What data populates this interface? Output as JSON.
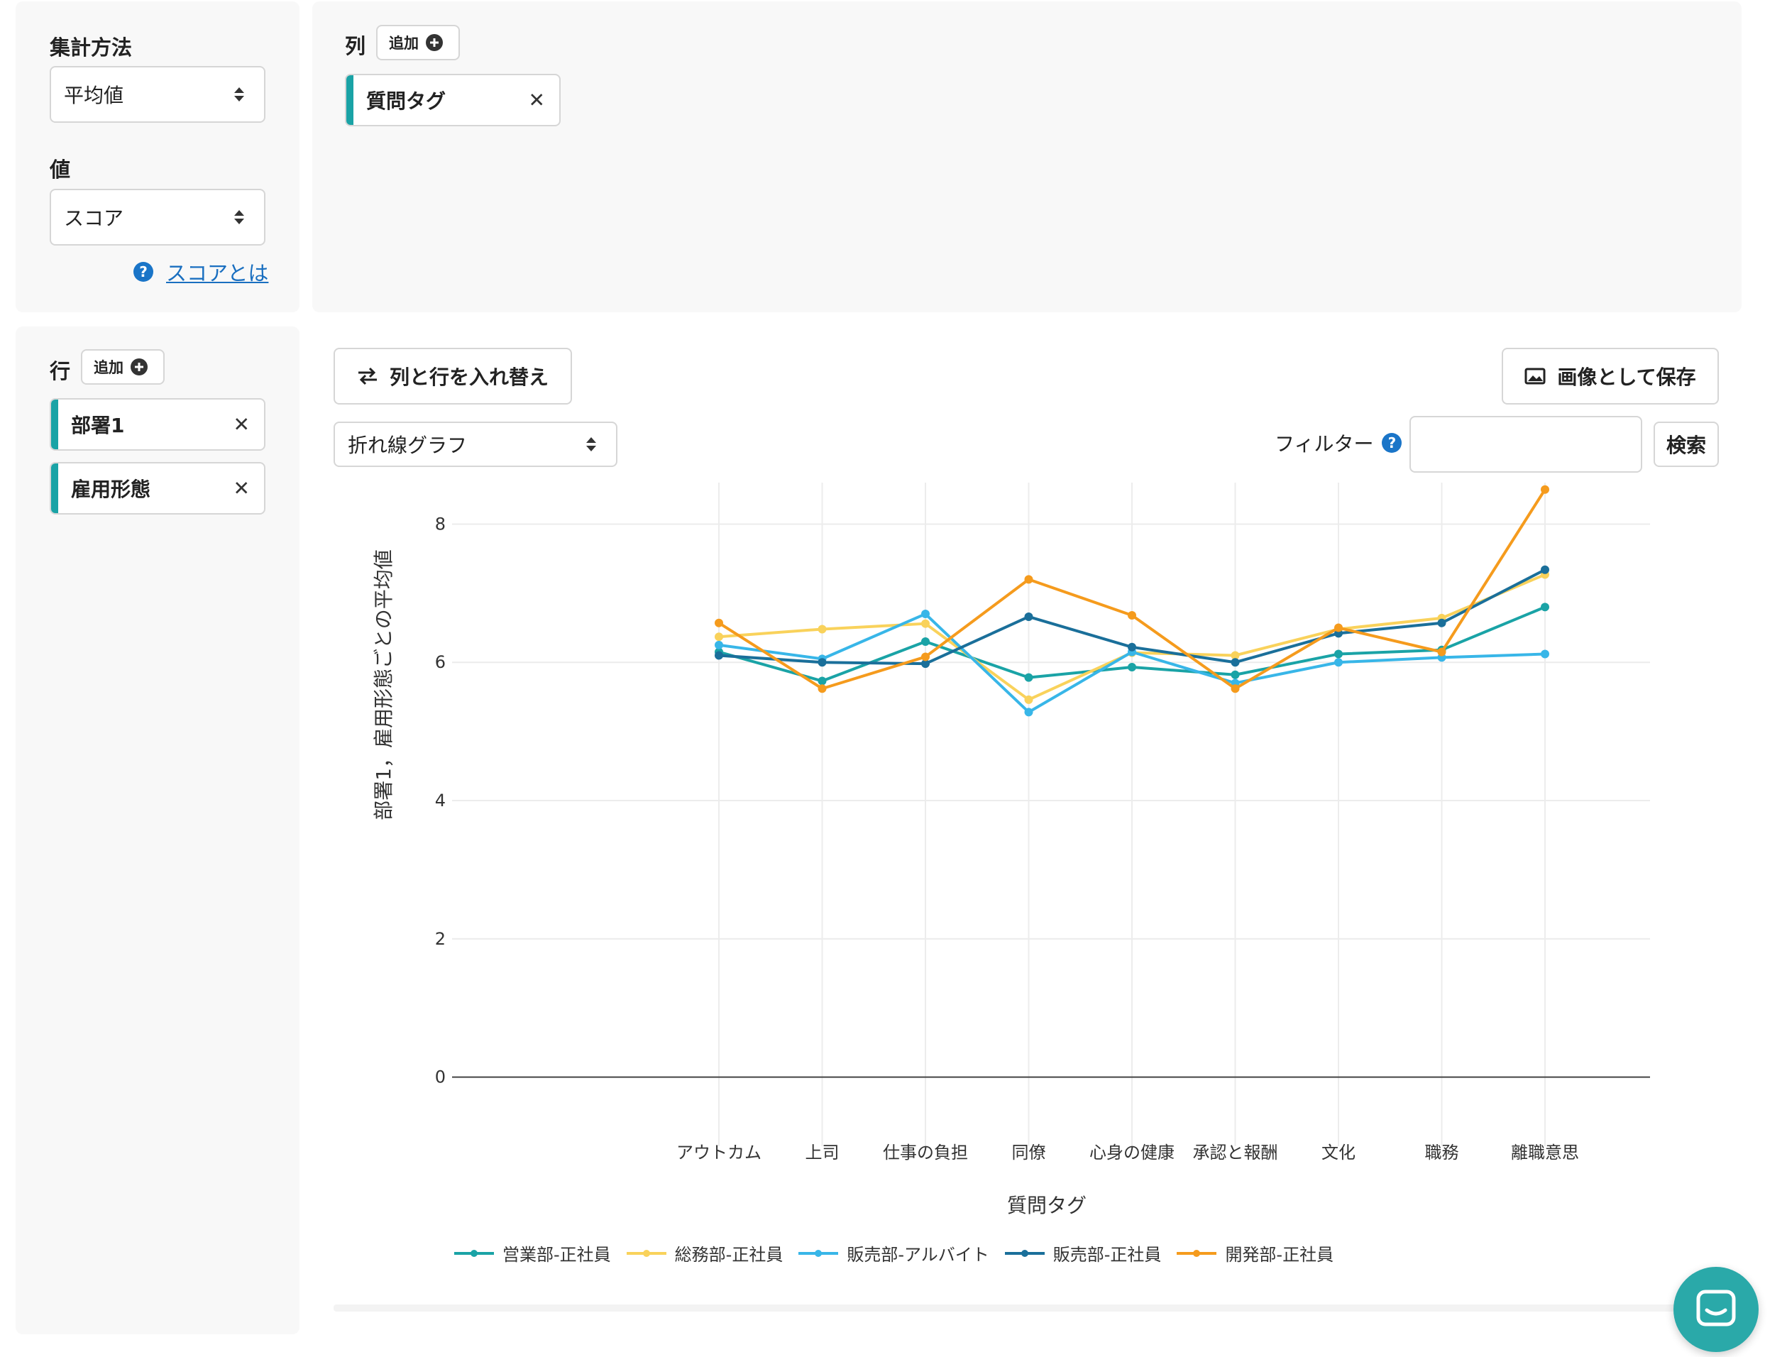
{
  "aggregation": {
    "method_label": "集計方法",
    "method_value": "平均値",
    "value_label": "値",
    "value_value": "スコア",
    "score_help_link": "スコアとは"
  },
  "columns": {
    "label": "列",
    "add_label": "追加",
    "chips": [
      {
        "label": "質問タグ"
      }
    ]
  },
  "rows": {
    "label": "行",
    "add_label": "追加",
    "chips": [
      {
        "label": "部署1"
      },
      {
        "label": "雇用形態"
      }
    ]
  },
  "toolbar": {
    "swap_label": "列と行を入れ替え",
    "save_image_label": "画像として保存",
    "chart_type_value": "折れ線グラフ",
    "filter_label": "フィルター",
    "search_label": "検索",
    "filter_value": ""
  },
  "icons": {
    "swap": "swap-arrows-icon",
    "save_image": "image-icon",
    "help": "question-circle-icon",
    "add": "plus-circle-icon",
    "remove": "close-icon",
    "select": "sort-arrows-icon",
    "chat": "chat-icon"
  },
  "chart_data": {
    "type": "line",
    "title": "",
    "xlabel": "質問タグ",
    "ylabel": "部署1，雇用形態ごとの平均値",
    "categories": [
      "アウトカム",
      "上司",
      "仕事の負担",
      "同僚",
      "心身の健康",
      "承認と報酬",
      "文化",
      "職務",
      "離職意思"
    ],
    "ylim": [
      -1,
      8.6
    ],
    "yticks": [
      0,
      2,
      4,
      6,
      8
    ],
    "grid": true,
    "legend_position": "bottom",
    "series": [
      {
        "name": "営業部-正社員",
        "color": "#1aa3a6",
        "values": [
          6.15,
          5.73,
          6.3,
          5.78,
          5.93,
          5.82,
          6.12,
          6.18,
          6.8
        ]
      },
      {
        "name": "総務部-正社員",
        "color": "#f9d25b",
        "values": [
          6.37,
          6.48,
          6.56,
          5.46,
          6.14,
          6.1,
          6.48,
          6.64,
          7.27
        ]
      },
      {
        "name": "販売部-アルバイト",
        "color": "#38b6e8",
        "values": [
          6.25,
          6.05,
          6.7,
          5.28,
          6.15,
          5.7,
          6.0,
          6.07,
          6.12
        ]
      },
      {
        "name": "販売部-正社員",
        "color": "#1a6f9a",
        "values": [
          6.1,
          6.0,
          5.98,
          6.66,
          6.22,
          6.0,
          6.42,
          6.57,
          7.34
        ]
      },
      {
        "name": "開発部-正社員",
        "color": "#f59b1d",
        "values": [
          6.57,
          5.62,
          6.08,
          7.2,
          6.68,
          5.62,
          6.5,
          6.15,
          8.5
        ]
      }
    ]
  }
}
